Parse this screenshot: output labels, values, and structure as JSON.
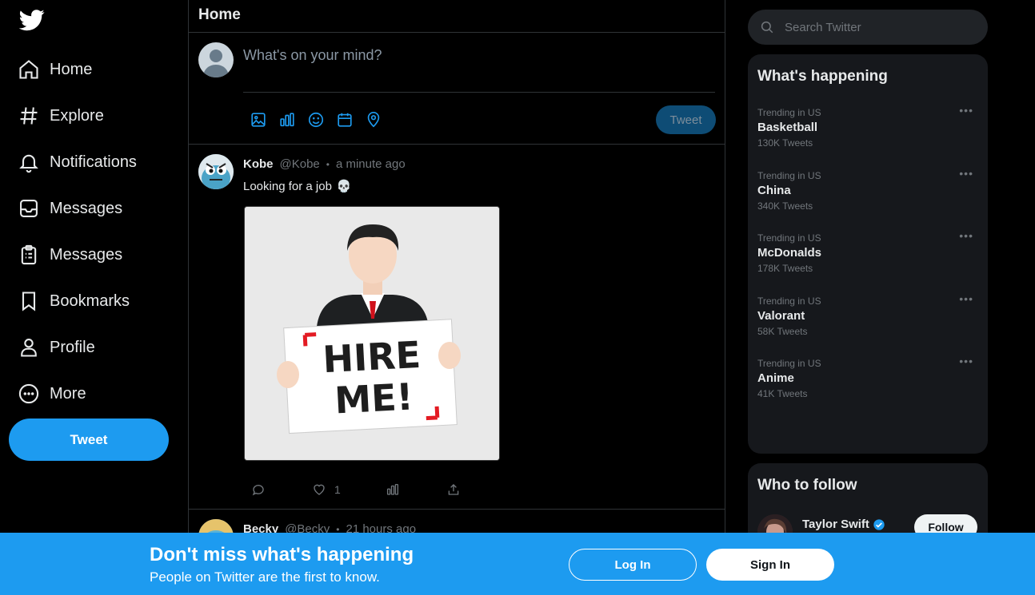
{
  "nav": {
    "items": [
      {
        "label": "Home",
        "icon": "home-icon"
      },
      {
        "label": "Explore",
        "icon": "hashtag-icon"
      },
      {
        "label": "Notifications",
        "icon": "bell-icon"
      },
      {
        "label": "Messages",
        "icon": "inbox-icon"
      },
      {
        "label": "Messages",
        "icon": "clipboard-icon"
      },
      {
        "label": "Bookmarks",
        "icon": "bookmark-icon"
      },
      {
        "label": "Profile",
        "icon": "user-icon"
      },
      {
        "label": "More",
        "icon": "more-circle-icon"
      }
    ],
    "tweet_label": "Tweet"
  },
  "header": {
    "title": "Home"
  },
  "composer": {
    "placeholder": "What's on your mind?",
    "tweet_label": "Tweet"
  },
  "posts": [
    {
      "name": "Kobe",
      "handle": "@Kobe",
      "time": "a minute ago",
      "text": "Looking for a job",
      "emoji": "💀",
      "media_text_line1": "HIRE",
      "media_text_line2": "ME!",
      "likes": "1"
    },
    {
      "name": "Becky",
      "handle": "@Becky",
      "time": "21 hours ago"
    }
  ],
  "search": {
    "placeholder": "Search Twitter"
  },
  "trends": {
    "title": "What's happening",
    "items": [
      {
        "category": "Trending in US",
        "name": "Basketball",
        "count": "130K Tweets"
      },
      {
        "category": "Trending in US",
        "name": "China",
        "count": "340K Tweets"
      },
      {
        "category": "Trending in US",
        "name": "McDonalds",
        "count": "178K Tweets"
      },
      {
        "category": "Trending in US",
        "name": "Valorant",
        "count": "58K Tweets"
      },
      {
        "category": "Trending in US",
        "name": "Anime",
        "count": "41K Tweets"
      }
    ],
    "more_label": "•••"
  },
  "who_to_follow": {
    "title": "Who to follow",
    "items": [
      {
        "name": "Taylor Swift",
        "follow_label": "Follow"
      }
    ]
  },
  "banner": {
    "title": "Don't miss what's happening",
    "subtitle": "People on Twitter are the first to know.",
    "login_label": "Log In",
    "signin_label": "Sign In"
  },
  "colors": {
    "accent": "#1d9bf0",
    "background": "#000000",
    "panel": "#16181c"
  }
}
